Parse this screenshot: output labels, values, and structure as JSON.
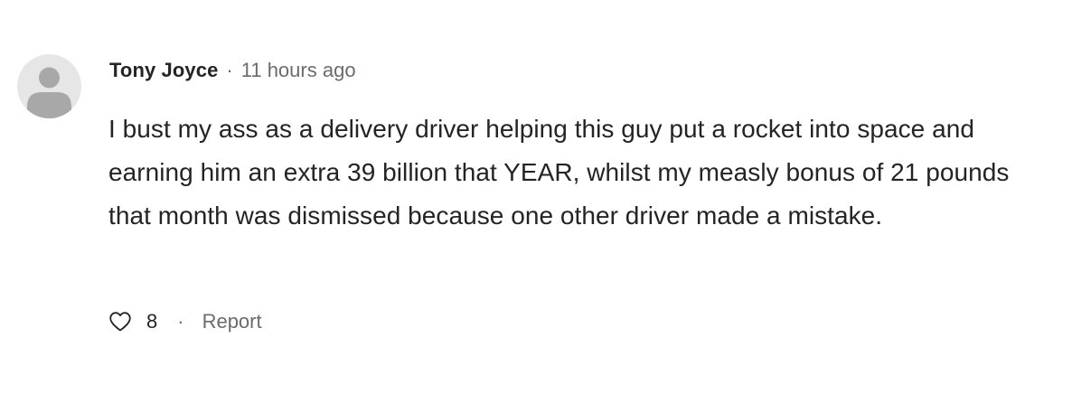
{
  "comment": {
    "author": "Tony Joyce",
    "separator": "·",
    "timestamp": "11 hours ago",
    "body": "I bust my ass as a delivery driver helping this guy put a rocket into space and earning him an extra 39 billion that YEAR, whilst my measly bonus of 21 pounds that month was dismissed because one other driver made a mistake.",
    "like_count": "8",
    "action_separator": "·",
    "report_label": "Report",
    "icons": {
      "avatar": "user-avatar-placeholder-icon",
      "like": "heart-outline-icon"
    },
    "colors": {
      "text_primary": "#242424",
      "text_secondary": "#6b6b6b",
      "avatar_bg": "#e6e6e6",
      "avatar_figure": "#a8a8a8"
    }
  }
}
